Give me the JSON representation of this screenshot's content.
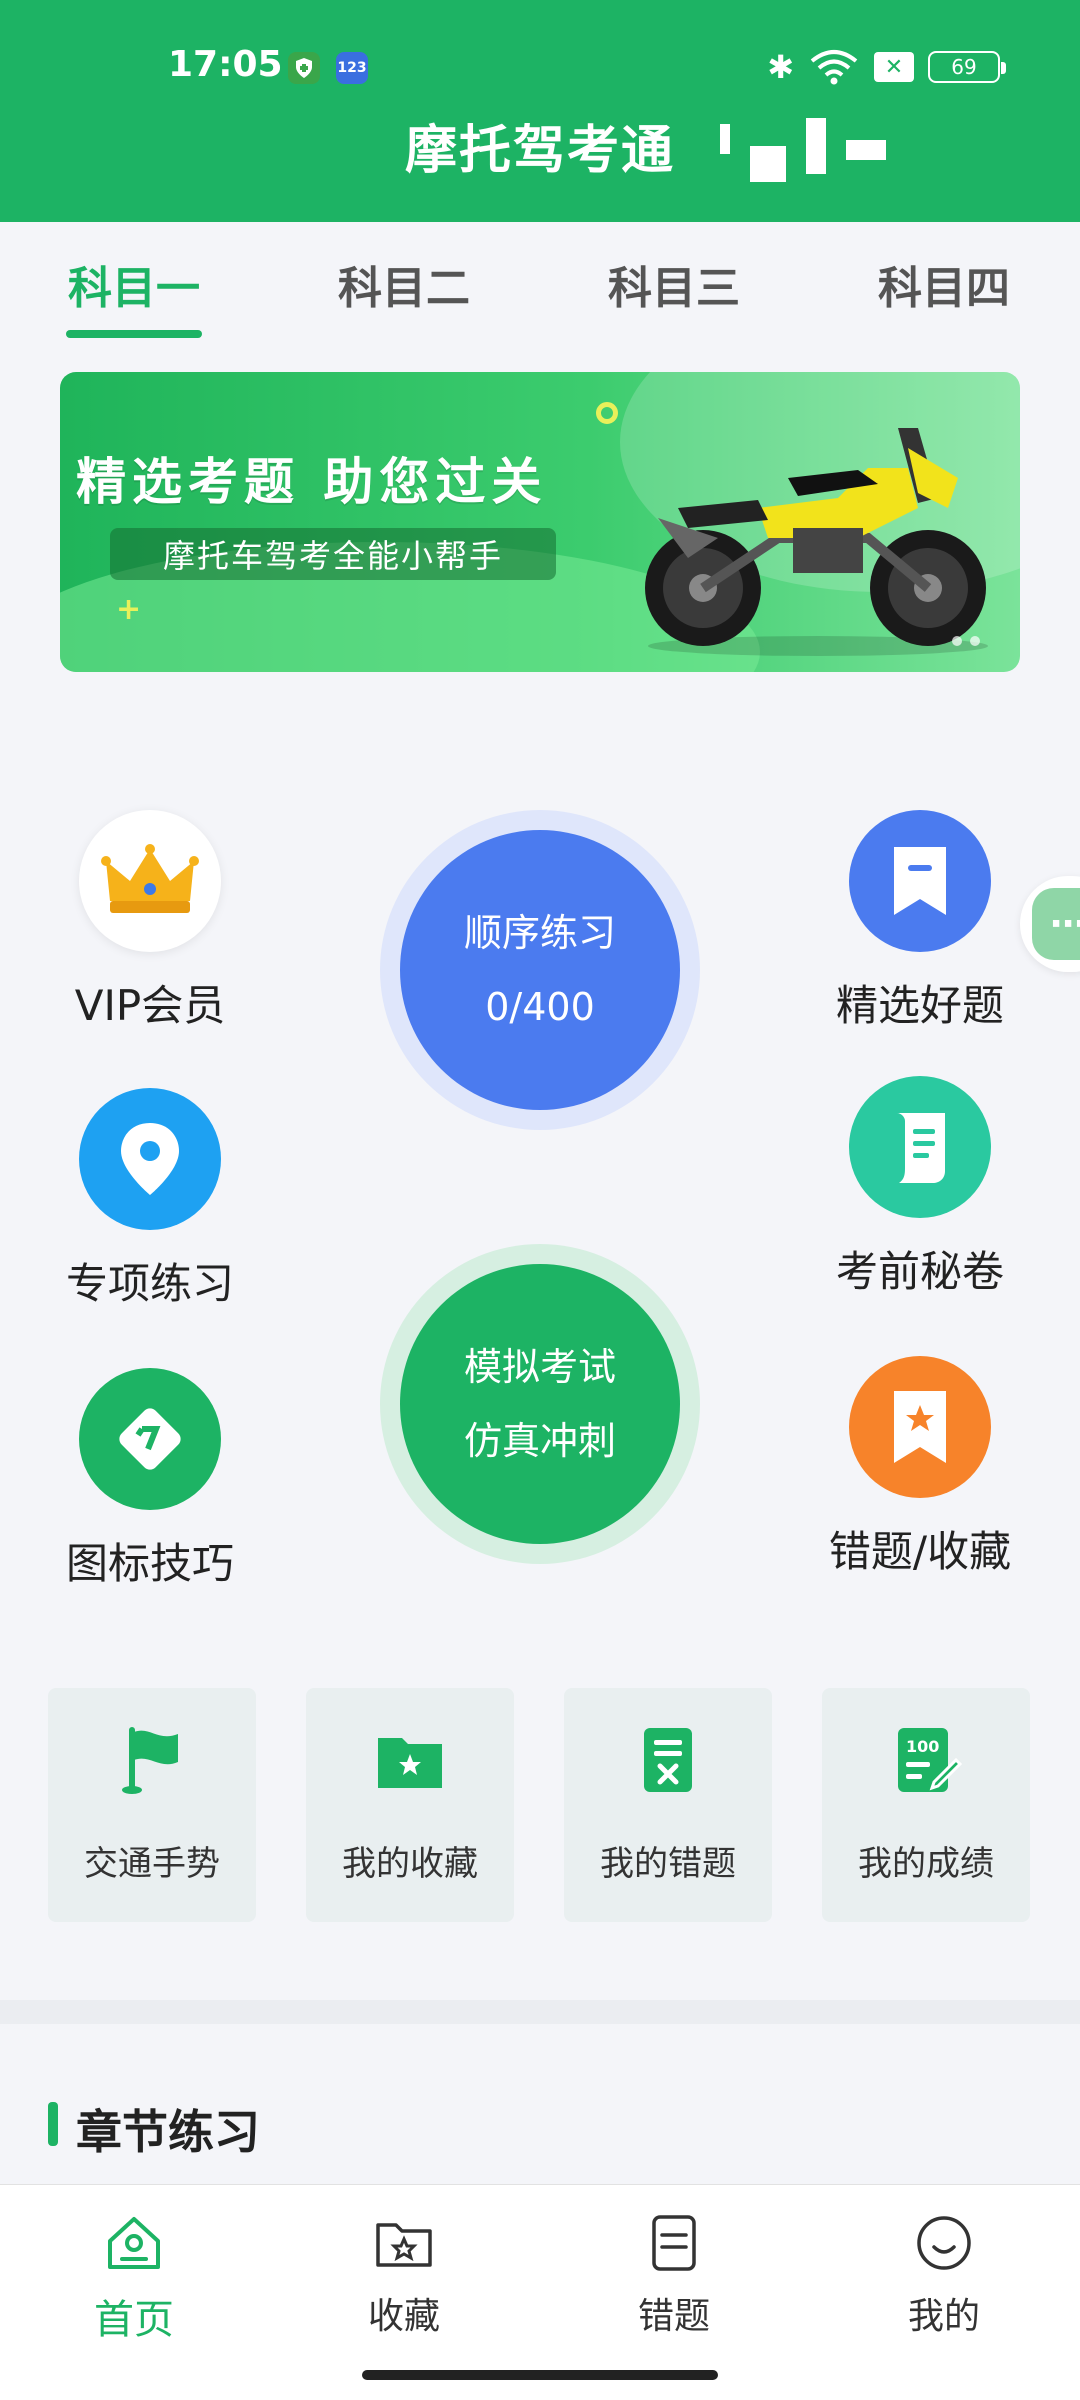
{
  "status_bar": {
    "time": "17:05",
    "badge_num": "123",
    "battery": "69"
  },
  "app": {
    "title": "摩托驾考通"
  },
  "tabs": [
    {
      "label": "科目一",
      "active": true
    },
    {
      "label": "科目二",
      "active": false
    },
    {
      "label": "科目三",
      "active": false
    },
    {
      "label": "科目四",
      "active": false
    }
  ],
  "banner": {
    "title": "精选考题  助您过关",
    "subtitle": "摩托车驾考全能小帮手"
  },
  "features": {
    "vip": {
      "label": "VIP会员",
      "icon": "crown-icon"
    },
    "special": {
      "label": "专项练习",
      "icon": "location-pin-icon"
    },
    "sign_tips": {
      "label": "图标技巧",
      "icon": "road-sign-icon"
    },
    "selected": {
      "label": "精选好题",
      "icon": "bookmark-icon"
    },
    "secret": {
      "label": "考前秘卷",
      "icon": "scroll-icon"
    },
    "wrong_fav": {
      "label": "错题/收藏",
      "icon": "star-bookmark-icon"
    }
  },
  "sequence_practice": {
    "label": "顺序练习",
    "progress": "0/400"
  },
  "mock_exam": {
    "line1": "模拟考试",
    "line2": "仿真冲刺"
  },
  "tiles": [
    {
      "label": "交通手势",
      "icon": "flag-icon"
    },
    {
      "label": "我的收藏",
      "icon": "star-folder-icon"
    },
    {
      "label": "我的错题",
      "icon": "wrong-doc-icon"
    },
    {
      "label": "我的成绩",
      "icon": "score-doc-icon"
    }
  ],
  "section": {
    "title": "章节练习"
  },
  "nav": [
    {
      "label": "首页",
      "icon": "home-icon",
      "active": true
    },
    {
      "label": "收藏",
      "icon": "star-folder-icon",
      "active": false
    },
    {
      "label": "错题",
      "icon": "list-doc-icon",
      "active": false
    },
    {
      "label": "我的",
      "icon": "smile-icon",
      "active": false
    }
  ],
  "colors": {
    "primary": "#1db364",
    "blue": "#4b7bef",
    "orange": "#f7832a",
    "teal": "#2ac9a0"
  }
}
